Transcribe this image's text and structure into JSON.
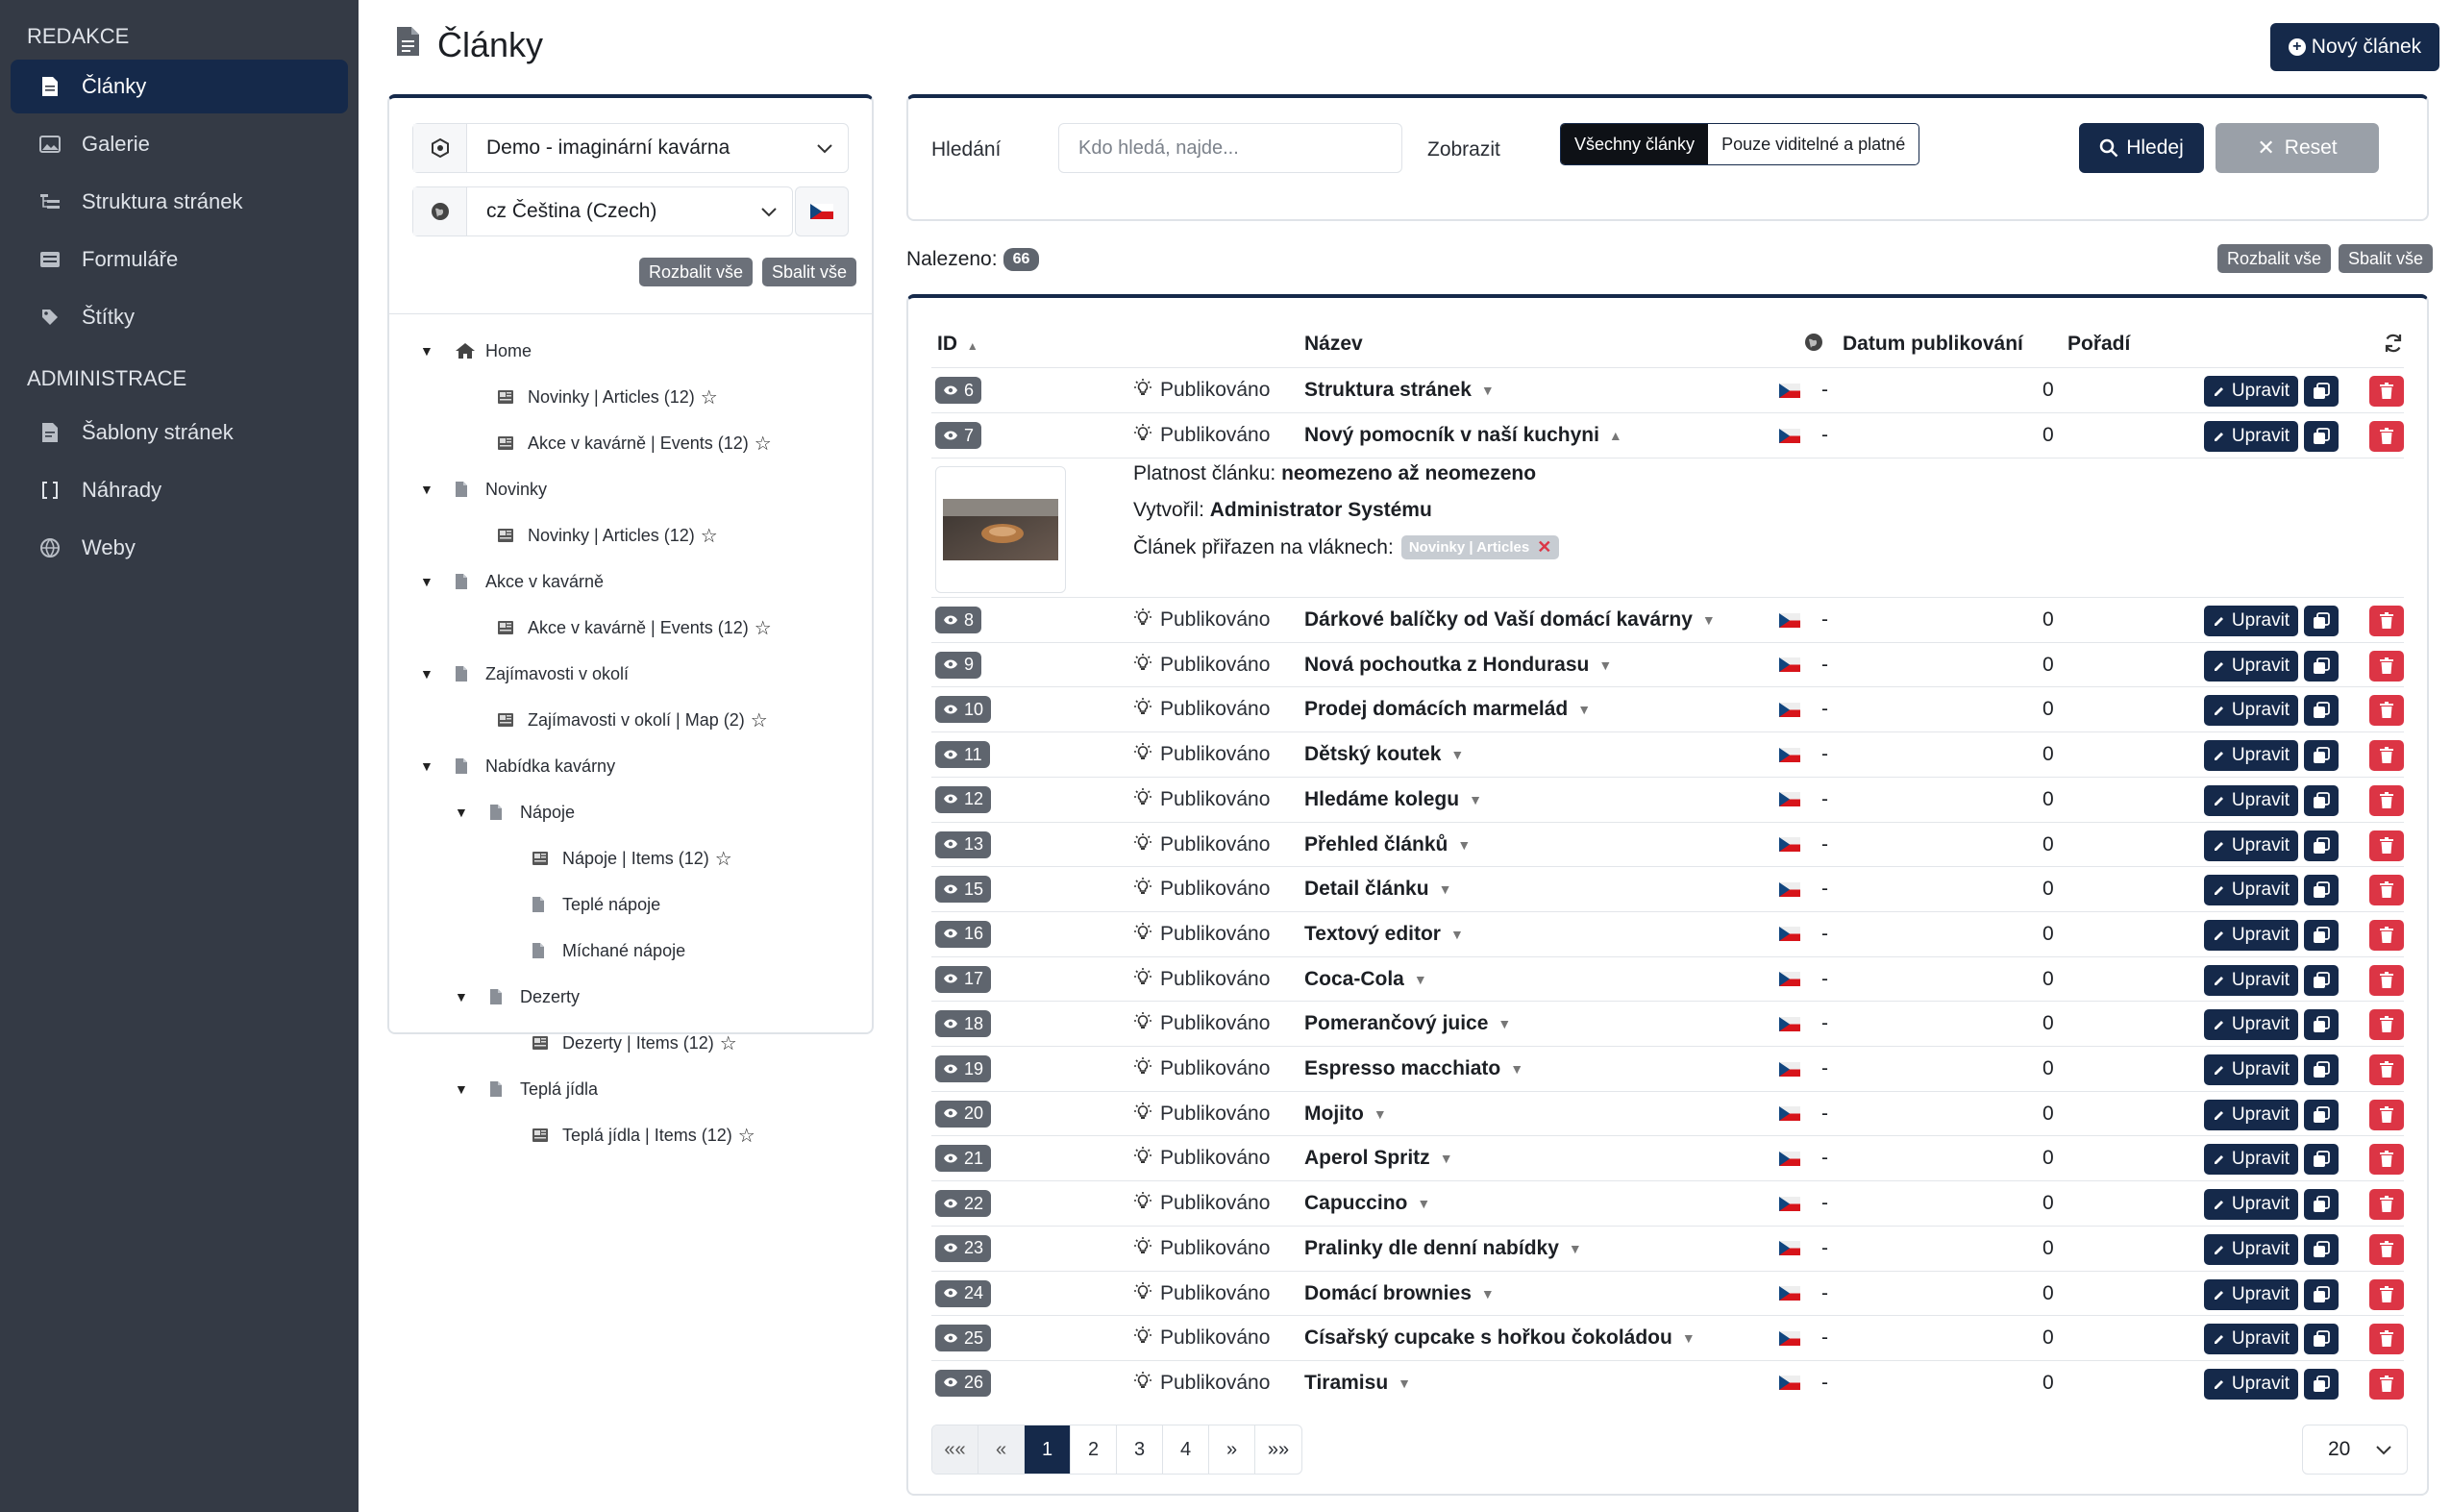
{
  "sidebar": {
    "section1": "REDAKCE",
    "section2": "ADMINISTRACE",
    "items1": [
      {
        "label": "Články",
        "icon": "document-icon",
        "active": true
      },
      {
        "label": "Galerie",
        "icon": "image-icon"
      },
      {
        "label": "Struktura stránek",
        "icon": "tree-structure-icon"
      },
      {
        "label": "Formuláře",
        "icon": "form-icon"
      },
      {
        "label": "Štítky",
        "icon": "tag-icon"
      }
    ],
    "items2": [
      {
        "label": "Šablony stránek",
        "icon": "template-icon"
      },
      {
        "label": "Náhrady",
        "icon": "brackets-icon"
      },
      {
        "label": "Weby",
        "icon": "globe-icon"
      }
    ]
  },
  "header": {
    "title": "Články",
    "new_button": "Nový článek"
  },
  "tree": {
    "site_select": "Demo - imaginární kavárna",
    "lang_select": "cz Čeština (Czech)",
    "expand_all": "Rozbalit vše",
    "collapse_all": "Sbalit vše",
    "nodes": [
      {
        "label": "Home",
        "level": 0,
        "toggle": true,
        "icon": "home-icon"
      },
      {
        "label": "Novinky | Articles (12)",
        "level": 1,
        "icon": "newspaper-icon",
        "star": true
      },
      {
        "label": "Akce v kavárně | Events (12)",
        "level": 1,
        "icon": "newspaper-icon",
        "star": true
      },
      {
        "label": "Novinky",
        "level": 0,
        "toggle": true,
        "icon": "page-icon"
      },
      {
        "label": "Novinky | Articles (12)",
        "level": 1,
        "icon": "newspaper-icon",
        "star": true
      },
      {
        "label": "Akce v kavárně",
        "level": 0,
        "toggle": true,
        "icon": "page-icon"
      },
      {
        "label": "Akce v kavárně | Events (12)",
        "level": 1,
        "icon": "newspaper-icon",
        "star": true
      },
      {
        "label": "Zajímavosti v okolí",
        "level": 0,
        "toggle": true,
        "icon": "page-icon"
      },
      {
        "label": "Zajímavosti v okolí | Map (2)",
        "level": 1,
        "icon": "newspaper-icon",
        "star": true
      },
      {
        "label": "Nabídka kavárny",
        "level": 0,
        "toggle": true,
        "icon": "page-icon"
      },
      {
        "label": "Nápoje",
        "level": 1,
        "toggle": true,
        "icon": "page-icon"
      },
      {
        "label": "Nápoje | Items (12)",
        "level": 2,
        "icon": "newspaper-icon",
        "star": true
      },
      {
        "label": "Teplé nápoje",
        "level": 2,
        "icon": "page-icon"
      },
      {
        "label": "Míchané nápoje",
        "level": 2,
        "icon": "page-icon"
      },
      {
        "label": "Dezerty",
        "level": 1,
        "toggle": true,
        "icon": "page-icon"
      },
      {
        "label": "Dezerty | Items (12)",
        "level": 2,
        "icon": "newspaper-icon",
        "star": true
      },
      {
        "label": "Teplá jídla",
        "level": 1,
        "toggle": true,
        "icon": "page-icon"
      },
      {
        "label": "Teplá jídla | Items (12)",
        "level": 2,
        "icon": "newspaper-icon",
        "star": true
      }
    ]
  },
  "search": {
    "label": "Hledání",
    "placeholder": "Kdo hledá, najde...",
    "show_label": "Zobrazit",
    "seg_all": "Všechny články",
    "seg_visible": "Pouze viditelné a platné",
    "search_button": "Hledej",
    "reset_button": "Reset"
  },
  "results": {
    "found_label": "Nalezeno:",
    "count": "66",
    "expand_all": "Rozbalit vše",
    "collapse_all": "Sbalit vše"
  },
  "table": {
    "col_id": "ID",
    "col_name": "Název",
    "col_date": "Datum publikování",
    "col_order": "Pořadí",
    "edit_label": "Upravit",
    "rows": [
      {
        "id": "6",
        "status": "Publikováno",
        "name": "Struktura stránek",
        "date": "-",
        "order": "0"
      },
      {
        "id": "7",
        "status": "Publikováno",
        "name": "Nový pomocník v naší kuchyni",
        "date": "-",
        "order": "0",
        "expanded": true
      },
      {
        "id": "8",
        "status": "Publikováno",
        "name": "Dárkové balíčky od Vaší domácí kavárny",
        "date": "-",
        "order": "0"
      },
      {
        "id": "9",
        "status": "Publikováno",
        "name": "Nová pochoutka z Hondurasu",
        "date": "-",
        "order": "0"
      },
      {
        "id": "10",
        "status": "Publikováno",
        "name": "Prodej domácích marmelád",
        "date": "-",
        "order": "0"
      },
      {
        "id": "11",
        "status": "Publikováno",
        "name": "Dětský koutek",
        "date": "-",
        "order": "0"
      },
      {
        "id": "12",
        "status": "Publikováno",
        "name": "Hledáme kolegu",
        "date": "-",
        "order": "0"
      },
      {
        "id": "13",
        "status": "Publikováno",
        "name": "Přehled článků",
        "date": "-",
        "order": "0"
      },
      {
        "id": "15",
        "status": "Publikováno",
        "name": "Detail článku",
        "date": "-",
        "order": "0"
      },
      {
        "id": "16",
        "status": "Publikováno",
        "name": "Textový editor",
        "date": "-",
        "order": "0"
      },
      {
        "id": "17",
        "status": "Publikováno",
        "name": "Coca-Cola",
        "date": "-",
        "order": "0"
      },
      {
        "id": "18",
        "status": "Publikováno",
        "name": "Pomerančový juice",
        "date": "-",
        "order": "0"
      },
      {
        "id": "19",
        "status": "Publikováno",
        "name": "Espresso macchiato",
        "date": "-",
        "order": "0"
      },
      {
        "id": "20",
        "status": "Publikováno",
        "name": "Mojito",
        "date": "-",
        "order": "0"
      },
      {
        "id": "21",
        "status": "Publikováno",
        "name": "Aperol Spritz",
        "date": "-",
        "order": "0"
      },
      {
        "id": "22",
        "status": "Publikováno",
        "name": "Capuccino",
        "date": "-",
        "order": "0"
      },
      {
        "id": "23",
        "status": "Publikováno",
        "name": "Pralinky dle denní nabídky",
        "date": "-",
        "order": "0"
      },
      {
        "id": "24",
        "status": "Publikováno",
        "name": "Domácí brownies",
        "date": "-",
        "order": "0"
      },
      {
        "id": "25",
        "status": "Publikováno",
        "name": "Císařský cupcake s hořkou čokoládou",
        "date": "-",
        "order": "0"
      },
      {
        "id": "26",
        "status": "Publikováno",
        "name": "Tiramisu",
        "date": "-",
        "order": "0"
      }
    ],
    "detail": {
      "validity_label": "Platnost článku:",
      "validity_from": "neomezeno",
      "validity_sep": "až",
      "validity_to": "neomezeno",
      "author_label": "Vytvořil:",
      "author": "Administrator Systému",
      "assigned_label": "Článek přiřazen na vláknech:",
      "tag": "Novinky | Articles"
    }
  },
  "pagination": {
    "first": "««",
    "prev": "«",
    "pages": [
      "1",
      "2",
      "3",
      "4"
    ],
    "next": "»",
    "last": "»»",
    "current": "1",
    "page_size": "20"
  },
  "colors": {
    "sidebar": "#343a45",
    "primary": "#15294a",
    "danger": "#dc3545",
    "badge": "#5f656e"
  }
}
